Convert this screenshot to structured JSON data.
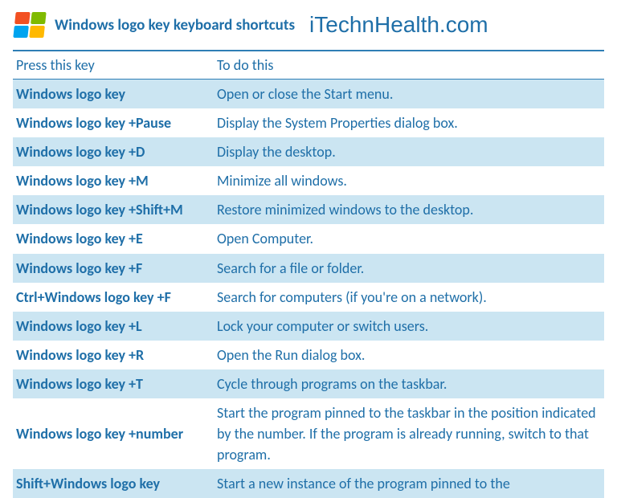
{
  "header": {
    "title": "Windows logo key keyboard shortcuts",
    "brand": "iTechnHealth.com"
  },
  "table": {
    "columns": {
      "key": "Press this key",
      "desc": "To do this"
    },
    "rows": [
      {
        "key": "Windows logo key",
        "desc": "Open or close the Start menu."
      },
      {
        "key": "Windows logo key +Pause",
        "desc": "Display the System Properties dialog box."
      },
      {
        "key": "Windows logo key +D",
        "desc": "Display the desktop."
      },
      {
        "key": "Windows logo key +M",
        "desc": "Minimize all windows."
      },
      {
        "key": "Windows logo key +Shift+M",
        "desc": "Restore minimized windows to the desktop."
      },
      {
        "key": "Windows logo key +E",
        "desc": "Open Computer."
      },
      {
        "key": "Windows logo key +F",
        "desc": "Search for a file or folder."
      },
      {
        "key": "Ctrl+Windows logo key +F",
        "desc": "Search for computers (if you're on a network)."
      },
      {
        "key": "Windows logo key +L",
        "desc": "Lock your computer or switch users."
      },
      {
        "key": "Windows logo key +R",
        "desc": "Open the Run dialog box."
      },
      {
        "key": "Windows logo key +T",
        "desc": "Cycle through programs on the taskbar."
      },
      {
        "key": "Windows logo key +number",
        "desc": "Start the program pinned to the taskbar in the position indicated by the number. If the program is already running, switch to that program."
      },
      {
        "key": "Shift+Windows logo key",
        "desc": "Start a new instance of the program pinned to the"
      }
    ]
  }
}
